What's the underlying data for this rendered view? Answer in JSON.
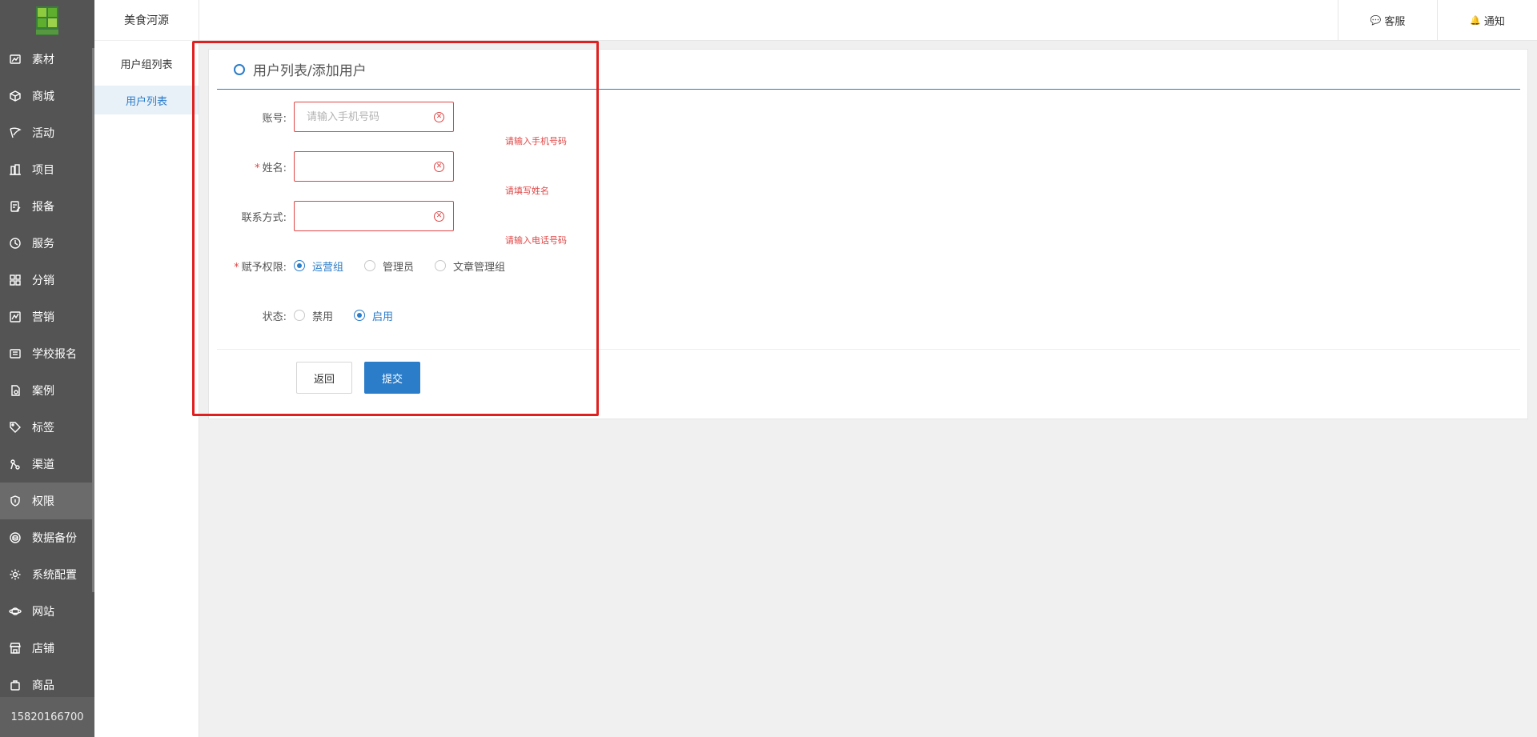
{
  "sidebar": {
    "items": [
      {
        "label": "素材",
        "icon": "chart-icon"
      },
      {
        "label": "商城",
        "icon": "box-icon"
      },
      {
        "label": "活动",
        "icon": "flag-icon"
      },
      {
        "label": "项目",
        "icon": "building-icon"
      },
      {
        "label": "报备",
        "icon": "edit-doc-icon"
      },
      {
        "label": "服务",
        "icon": "clock-icon"
      },
      {
        "label": "分销",
        "icon": "grid-icon"
      },
      {
        "label": "营销",
        "icon": "analytics-icon"
      },
      {
        "label": "学校报名",
        "icon": "list-board-icon"
      },
      {
        "label": "案例",
        "icon": "file-search-icon"
      },
      {
        "label": "标签",
        "icon": "tag-icon"
      },
      {
        "label": "渠道",
        "icon": "channel-icon"
      },
      {
        "label": "权限",
        "icon": "shield-icon"
      },
      {
        "label": "数据备份",
        "icon": "database-icon"
      },
      {
        "label": "系统配置",
        "icon": "gear-icon"
      },
      {
        "label": "网站",
        "icon": "planet-icon"
      },
      {
        "label": "店铺",
        "icon": "store-icon"
      },
      {
        "label": "商品",
        "icon": "bag-icon"
      }
    ],
    "active_index": 12,
    "phone": "15820166700"
  },
  "submenu": {
    "title": "美食河源",
    "items": [
      "用户组列表",
      "用户列表"
    ],
    "active_index": 1
  },
  "topbar": {
    "service_label": "客服",
    "notify_label": "通知"
  },
  "card": {
    "title": "用户列表/添加用户"
  },
  "form": {
    "account": {
      "label": "账号:",
      "placeholder": "请输入手机号码",
      "value": "",
      "error": "请输入手机号码"
    },
    "name": {
      "label": "姓名:",
      "required": "*",
      "value": "",
      "error": "请填写姓名"
    },
    "contact": {
      "label": "联系方式:",
      "value": "",
      "error": "请输入电话号码"
    },
    "permission": {
      "label": "赋予权限:",
      "required": "*",
      "options": [
        "运营组",
        "管理员",
        "文章管理组"
      ],
      "selected": "运营组"
    },
    "status": {
      "label": "状态:",
      "options": [
        "禁用",
        "启用"
      ],
      "selected": "启用"
    },
    "back_label": "返回",
    "submit_label": "提交"
  },
  "colors": {
    "accent": "#2b7cc9",
    "error": "#e04545",
    "sidebar_bg": "#545454",
    "highlight": "#e02020"
  }
}
